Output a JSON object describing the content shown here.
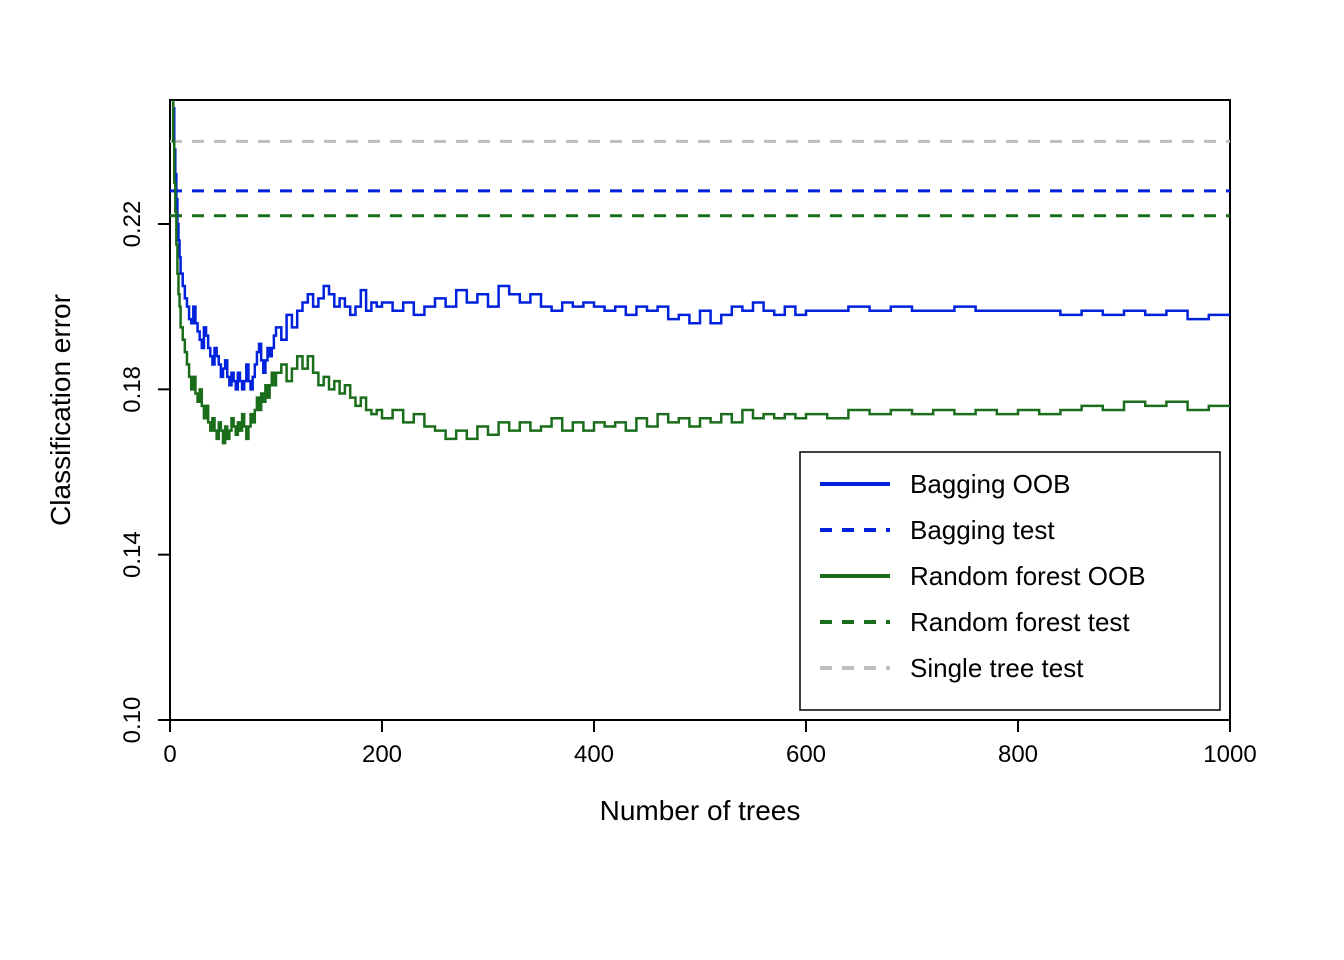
{
  "chart_data": {
    "type": "line",
    "xlabel": "Number of trees",
    "ylabel": "Classification error",
    "xlim": [
      0,
      1000
    ],
    "ylim": [
      0.1,
      0.25
    ],
    "xticks": [
      0,
      200,
      400,
      600,
      800,
      1000
    ],
    "yticks": [
      0.1,
      0.14,
      0.18,
      0.22
    ],
    "hlines": [
      {
        "name": "Single tree test",
        "value": 0.24,
        "color": "#bfbfbf",
        "dash": "12,10"
      },
      {
        "name": "Bagging test",
        "value": 0.228,
        "color": "#0022dd",
        "dash": "12,10"
      },
      {
        "name": "Random forest test",
        "value": 0.222,
        "color": "#1a6d1a",
        "dash": "12,10"
      }
    ],
    "series": [
      {
        "name": "Bagging OOB",
        "color": "#0022dd",
        "dash": "",
        "data": [
          [
            1,
            0.3
          ],
          [
            2,
            0.26
          ],
          [
            3,
            0.248
          ],
          [
            4,
            0.238
          ],
          [
            5,
            0.232
          ],
          [
            6,
            0.226
          ],
          [
            7,
            0.22
          ],
          [
            8,
            0.216
          ],
          [
            9,
            0.212
          ],
          [
            10,
            0.208
          ],
          [
            12,
            0.205
          ],
          [
            14,
            0.202
          ],
          [
            16,
            0.2
          ],
          [
            18,
            0.197
          ],
          [
            20,
            0.196
          ],
          [
            22,
            0.2
          ],
          [
            24,
            0.196
          ],
          [
            26,
            0.194
          ],
          [
            28,
            0.192
          ],
          [
            30,
            0.19
          ],
          [
            32,
            0.195
          ],
          [
            34,
            0.193
          ],
          [
            36,
            0.19
          ],
          [
            38,
            0.188
          ],
          [
            40,
            0.186
          ],
          [
            42,
            0.19
          ],
          [
            44,
            0.188
          ],
          [
            46,
            0.186
          ],
          [
            48,
            0.183
          ],
          [
            50,
            0.185
          ],
          [
            52,
            0.187
          ],
          [
            54,
            0.183
          ],
          [
            56,
            0.181
          ],
          [
            58,
            0.184
          ],
          [
            60,
            0.182
          ],
          [
            62,
            0.18
          ],
          [
            64,
            0.184
          ],
          [
            66,
            0.182
          ],
          [
            68,
            0.18
          ],
          [
            70,
            0.182
          ],
          [
            72,
            0.186
          ],
          [
            74,
            0.182
          ],
          [
            76,
            0.18
          ],
          [
            78,
            0.183
          ],
          [
            80,
            0.186
          ],
          [
            82,
            0.189
          ],
          [
            84,
            0.191
          ],
          [
            86,
            0.187
          ],
          [
            88,
            0.184
          ],
          [
            90,
            0.187
          ],
          [
            92,
            0.19
          ],
          [
            94,
            0.188
          ],
          [
            96,
            0.19
          ],
          [
            98,
            0.193
          ],
          [
            100,
            0.195
          ],
          [
            105,
            0.192
          ],
          [
            110,
            0.198
          ],
          [
            115,
            0.195
          ],
          [
            120,
            0.199
          ],
          [
            125,
            0.201
          ],
          [
            130,
            0.203
          ],
          [
            135,
            0.2
          ],
          [
            140,
            0.202
          ],
          [
            145,
            0.205
          ],
          [
            150,
            0.203
          ],
          [
            155,
            0.2
          ],
          [
            160,
            0.202
          ],
          [
            165,
            0.2
          ],
          [
            170,
            0.198
          ],
          [
            175,
            0.2
          ],
          [
            180,
            0.204
          ],
          [
            185,
            0.199
          ],
          [
            190,
            0.201
          ],
          [
            195,
            0.2
          ],
          [
            200,
            0.201
          ],
          [
            210,
            0.199
          ],
          [
            220,
            0.201
          ],
          [
            230,
            0.198
          ],
          [
            240,
            0.2
          ],
          [
            250,
            0.202
          ],
          [
            260,
            0.2
          ],
          [
            270,
            0.204
          ],
          [
            280,
            0.201
          ],
          [
            290,
            0.203
          ],
          [
            300,
            0.2
          ],
          [
            310,
            0.205
          ],
          [
            320,
            0.203
          ],
          [
            330,
            0.201
          ],
          [
            340,
            0.203
          ],
          [
            350,
            0.2
          ],
          [
            360,
            0.199
          ],
          [
            370,
            0.201
          ],
          [
            380,
            0.2
          ],
          [
            390,
            0.201
          ],
          [
            400,
            0.2
          ],
          [
            410,
            0.199
          ],
          [
            420,
            0.2
          ],
          [
            430,
            0.198
          ],
          [
            440,
            0.2
          ],
          [
            450,
            0.199
          ],
          [
            460,
            0.2
          ],
          [
            470,
            0.197
          ],
          [
            480,
            0.198
          ],
          [
            490,
            0.196
          ],
          [
            500,
            0.199
          ],
          [
            510,
            0.196
          ],
          [
            520,
            0.198
          ],
          [
            530,
            0.2
          ],
          [
            540,
            0.199
          ],
          [
            550,
            0.201
          ],
          [
            560,
            0.199
          ],
          [
            570,
            0.198
          ],
          [
            580,
            0.2
          ],
          [
            590,
            0.198
          ],
          [
            600,
            0.199
          ],
          [
            620,
            0.199
          ],
          [
            640,
            0.2
          ],
          [
            660,
            0.199
          ],
          [
            680,
            0.2
          ],
          [
            700,
            0.199
          ],
          [
            720,
            0.199
          ],
          [
            740,
            0.2
          ],
          [
            760,
            0.199
          ],
          [
            780,
            0.199
          ],
          [
            800,
            0.199
          ],
          [
            820,
            0.199
          ],
          [
            840,
            0.198
          ],
          [
            860,
            0.199
          ],
          [
            880,
            0.198
          ],
          [
            900,
            0.199
          ],
          [
            920,
            0.198
          ],
          [
            940,
            0.199
          ],
          [
            960,
            0.197
          ],
          [
            980,
            0.198
          ],
          [
            1000,
            0.198
          ]
        ]
      },
      {
        "name": "Random forest OOB",
        "color": "#1a6d1a",
        "dash": "",
        "data": [
          [
            1,
            0.3
          ],
          [
            2,
            0.255
          ],
          [
            3,
            0.24
          ],
          [
            4,
            0.23
          ],
          [
            5,
            0.223
          ],
          [
            6,
            0.215
          ],
          [
            7,
            0.208
          ],
          [
            8,
            0.203
          ],
          [
            9,
            0.2
          ],
          [
            10,
            0.195
          ],
          [
            12,
            0.192
          ],
          [
            14,
            0.189
          ],
          [
            16,
            0.186
          ],
          [
            18,
            0.183
          ],
          [
            20,
            0.18
          ],
          [
            22,
            0.183
          ],
          [
            24,
            0.179
          ],
          [
            26,
            0.177
          ],
          [
            28,
            0.18
          ],
          [
            30,
            0.176
          ],
          [
            32,
            0.173
          ],
          [
            34,
            0.176
          ],
          [
            36,
            0.172
          ],
          [
            38,
            0.17
          ],
          [
            40,
            0.173
          ],
          [
            42,
            0.17
          ],
          [
            44,
            0.168
          ],
          [
            46,
            0.172
          ],
          [
            48,
            0.17
          ],
          [
            50,
            0.167
          ],
          [
            52,
            0.171
          ],
          [
            54,
            0.168
          ],
          [
            56,
            0.17
          ],
          [
            58,
            0.173
          ],
          [
            60,
            0.171
          ],
          [
            62,
            0.169
          ],
          [
            64,
            0.172
          ],
          [
            66,
            0.17
          ],
          [
            68,
            0.174
          ],
          [
            70,
            0.171
          ],
          [
            72,
            0.168
          ],
          [
            74,
            0.171
          ],
          [
            76,
            0.174
          ],
          [
            78,
            0.172
          ],
          [
            80,
            0.175
          ],
          [
            82,
            0.178
          ],
          [
            84,
            0.175
          ],
          [
            86,
            0.179
          ],
          [
            88,
            0.177
          ],
          [
            90,
            0.181
          ],
          [
            92,
            0.178
          ],
          [
            94,
            0.181
          ],
          [
            96,
            0.184
          ],
          [
            98,
            0.181
          ],
          [
            100,
            0.184
          ],
          [
            105,
            0.186
          ],
          [
            110,
            0.182
          ],
          [
            115,
            0.185
          ],
          [
            120,
            0.188
          ],
          [
            125,
            0.185
          ],
          [
            130,
            0.188
          ],
          [
            135,
            0.184
          ],
          [
            140,
            0.181
          ],
          [
            145,
            0.183
          ],
          [
            150,
            0.18
          ],
          [
            155,
            0.182
          ],
          [
            160,
            0.179
          ],
          [
            165,
            0.181
          ],
          [
            170,
            0.178
          ],
          [
            175,
            0.176
          ],
          [
            180,
            0.178
          ],
          [
            185,
            0.175
          ],
          [
            190,
            0.174
          ],
          [
            195,
            0.175
          ],
          [
            200,
            0.173
          ],
          [
            210,
            0.175
          ],
          [
            220,
            0.172
          ],
          [
            230,
            0.174
          ],
          [
            240,
            0.171
          ],
          [
            250,
            0.17
          ],
          [
            260,
            0.168
          ],
          [
            270,
            0.17
          ],
          [
            280,
            0.168
          ],
          [
            290,
            0.171
          ],
          [
            300,
            0.169
          ],
          [
            310,
            0.172
          ],
          [
            320,
            0.17
          ],
          [
            330,
            0.172
          ],
          [
            340,
            0.17
          ],
          [
            350,
            0.171
          ],
          [
            360,
            0.173
          ],
          [
            370,
            0.17
          ],
          [
            380,
            0.172
          ],
          [
            390,
            0.17
          ],
          [
            400,
            0.172
          ],
          [
            410,
            0.171
          ],
          [
            420,
            0.172
          ],
          [
            430,
            0.17
          ],
          [
            440,
            0.173
          ],
          [
            450,
            0.171
          ],
          [
            460,
            0.174
          ],
          [
            470,
            0.172
          ],
          [
            480,
            0.173
          ],
          [
            490,
            0.171
          ],
          [
            500,
            0.173
          ],
          [
            510,
            0.172
          ],
          [
            520,
            0.174
          ],
          [
            530,
            0.172
          ],
          [
            540,
            0.175
          ],
          [
            550,
            0.173
          ],
          [
            560,
            0.174
          ],
          [
            570,
            0.173
          ],
          [
            580,
            0.174
          ],
          [
            590,
            0.173
          ],
          [
            600,
            0.174
          ],
          [
            620,
            0.173
          ],
          [
            640,
            0.175
          ],
          [
            660,
            0.174
          ],
          [
            680,
            0.175
          ],
          [
            700,
            0.174
          ],
          [
            720,
            0.175
          ],
          [
            740,
            0.174
          ],
          [
            760,
            0.175
          ],
          [
            780,
            0.174
          ],
          [
            800,
            0.175
          ],
          [
            820,
            0.174
          ],
          [
            840,
            0.175
          ],
          [
            860,
            0.176
          ],
          [
            880,
            0.175
          ],
          [
            900,
            0.177
          ],
          [
            920,
            0.176
          ],
          [
            940,
            0.177
          ],
          [
            960,
            0.175
          ],
          [
            980,
            0.176
          ],
          [
            1000,
            0.176
          ]
        ]
      }
    ],
    "legend": {
      "position": "bottom-right",
      "items": [
        {
          "label": "Bagging OOB",
          "color": "#0022dd",
          "dash": ""
        },
        {
          "label": "Bagging test",
          "color": "#0022dd",
          "dash": "12,10"
        },
        {
          "label": "Random forest OOB",
          "color": "#1a6d1a",
          "dash": ""
        },
        {
          "label": "Random forest test",
          "color": "#1a6d1a",
          "dash": "12,10"
        },
        {
          "label": "Single tree test",
          "color": "#bfbfbf",
          "dash": "12,10"
        }
      ]
    }
  },
  "yticks_labels": [
    "0.10",
    "0.14",
    "0.18",
    "0.22"
  ],
  "xticks_labels": [
    "0",
    "200",
    "400",
    "600",
    "800",
    "1000"
  ]
}
